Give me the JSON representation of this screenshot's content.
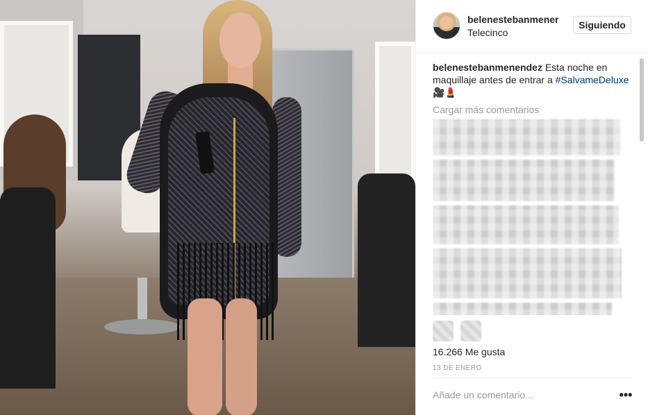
{
  "post": {
    "author": "belenestebanmener",
    "location": "Telecinco",
    "follow_label": "Siguiendo"
  },
  "caption": {
    "user": "belenestebanmenendez",
    "text": " Esta noche en maquillaje antes de entrar a ",
    "hashtag": "#SalvameDeluxe",
    "emoji": " 🎥💄"
  },
  "comments": {
    "load_more": "Cargar más comentarios"
  },
  "likes": "16.266 Me gusta",
  "date": "13 DE ENERO",
  "comment_box": {
    "placeholder": "Añade un comentario..."
  },
  "more_options": "•••",
  "icons": {
    "like": "heart-icon",
    "comment": "comment-icon",
    "more": "more-options-icon"
  },
  "colors": {
    "hashtag": "#003569",
    "muted": "#999999",
    "text": "#262626"
  }
}
